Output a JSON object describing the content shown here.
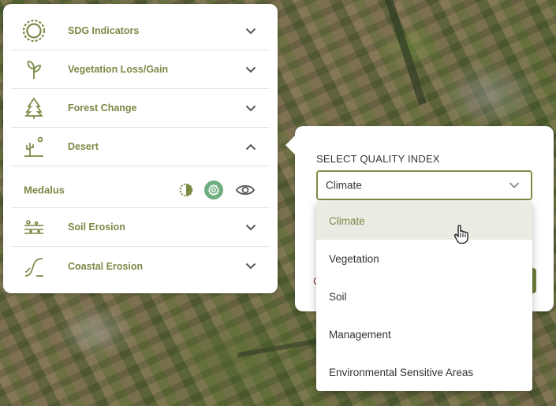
{
  "panel": {
    "layers": [
      {
        "label": "SDG Indicators",
        "icon": "sun-ring-icon",
        "expanded": false
      },
      {
        "label": "Vegetation Loss/Gain",
        "icon": "sprout-icon",
        "expanded": false
      },
      {
        "label": "Forest Change",
        "icon": "tree-icon",
        "expanded": false
      },
      {
        "label": "Desert",
        "icon": "cactus-icon",
        "expanded": true
      },
      {
        "label": "Soil Erosion",
        "icon": "soil-layers-icon",
        "expanded": false
      },
      {
        "label": "Coastal Erosion",
        "icon": "coast-wave-icon",
        "expanded": false
      }
    ],
    "sublayer": {
      "label": "Medalus",
      "icons": [
        "contrast-icon",
        "settings-icon",
        "eye-icon"
      ]
    }
  },
  "popover": {
    "title": "SELECT QUALITY INDEX",
    "selected": "Climate",
    "partial_text": "C"
  },
  "menu": {
    "options": [
      "Climate",
      "Vegetation",
      "Soil",
      "Management",
      "Environmental Sensitive Areas"
    ],
    "active_index": 0
  },
  "colors": {
    "accent": "#7a8a45",
    "accent_button": "#6fae7f",
    "border": "#7d8d47",
    "active_bg": "#ebebe4"
  }
}
